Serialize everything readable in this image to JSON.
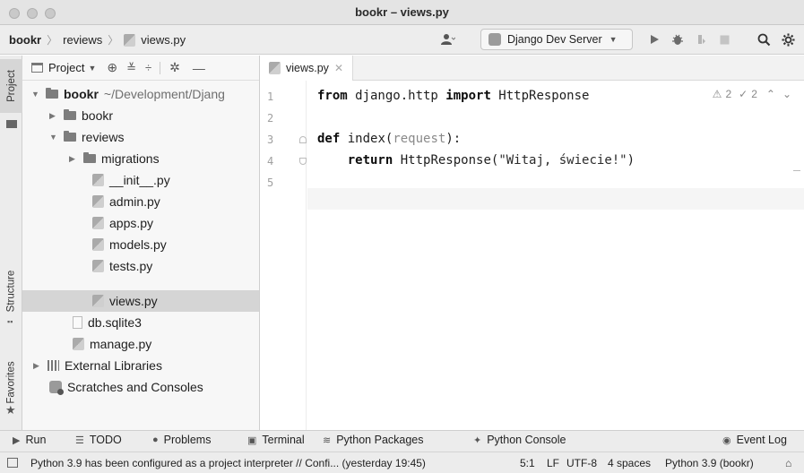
{
  "window": {
    "title": "bookr – views.py"
  },
  "breadcrumb": {
    "items": [
      "bookr",
      "reviews",
      "views.py"
    ]
  },
  "toolbar": {
    "run_config": "Django Dev Server",
    "icons": [
      "user-icon",
      "run-icon",
      "debug-icon",
      "coverage-icon",
      "stop-icon",
      "search-icon",
      "gear-icon"
    ]
  },
  "left_stripe": {
    "tabs": [
      "Project",
      "Structure",
      "Favorites"
    ]
  },
  "project_panel": {
    "header_label": "Project",
    "tree": [
      {
        "label": "bookr",
        "suffix": "~/Development/Djang",
        "type": "folder",
        "level": 0,
        "expanded": true,
        "bold": true
      },
      {
        "label": "bookr",
        "type": "folder",
        "level": 1,
        "expanded": false
      },
      {
        "label": "reviews",
        "type": "folder",
        "level": 1,
        "expanded": true
      },
      {
        "label": "migrations",
        "type": "folder",
        "level": 2,
        "expanded": false
      },
      {
        "label": "__init__.py",
        "type": "py",
        "level": 2
      },
      {
        "label": "admin.py",
        "type": "py",
        "level": 2
      },
      {
        "label": "apps.py",
        "type": "py",
        "level": 2
      },
      {
        "label": "models.py",
        "type": "py",
        "level": 2
      },
      {
        "label": "tests.py",
        "type": "py",
        "level": 2
      },
      {
        "label": "views.py",
        "type": "py",
        "level": 2,
        "selected": true
      },
      {
        "label": "db.sqlite3",
        "type": "file",
        "level": 1
      },
      {
        "label": "manage.py",
        "type": "py",
        "level": 1
      },
      {
        "label": "External Libraries",
        "type": "lib",
        "level": 0,
        "expanded": false
      },
      {
        "label": "Scratches and Consoles",
        "type": "scratch",
        "level": 0
      }
    ]
  },
  "editor": {
    "tab_label": "views.py",
    "line_numbers": [
      "1",
      "2",
      "3",
      "4",
      "5"
    ],
    "code": {
      "l1_kw1": "from",
      "l1_mid": " django.http ",
      "l1_kw2": "import",
      "l1_end": " HttpResponse",
      "l3_kw": "def",
      "l3_name": " index(",
      "l3_param": "request",
      "l3_end": "):",
      "l4_kw": "return",
      "l4_call": " HttpResponse(",
      "l4_str": "\"Witaj, świecie!\"",
      "l4_end": ")"
    },
    "inspections": {
      "warnings": "2",
      "typos": "2"
    }
  },
  "bottom_tools": [
    "Run",
    "TODO",
    "Problems",
    "Terminal",
    "Python Packages",
    "Python Console",
    "Event Log"
  ],
  "status": {
    "message": "Python 3.9 has been configured as a project interpreter // Confi... (yesterday 19:45)",
    "position": "5:1",
    "line_sep": "LF",
    "encoding": "UTF-8",
    "indent": "4 spaces",
    "interpreter": "Python 3.9 (bookr)"
  }
}
